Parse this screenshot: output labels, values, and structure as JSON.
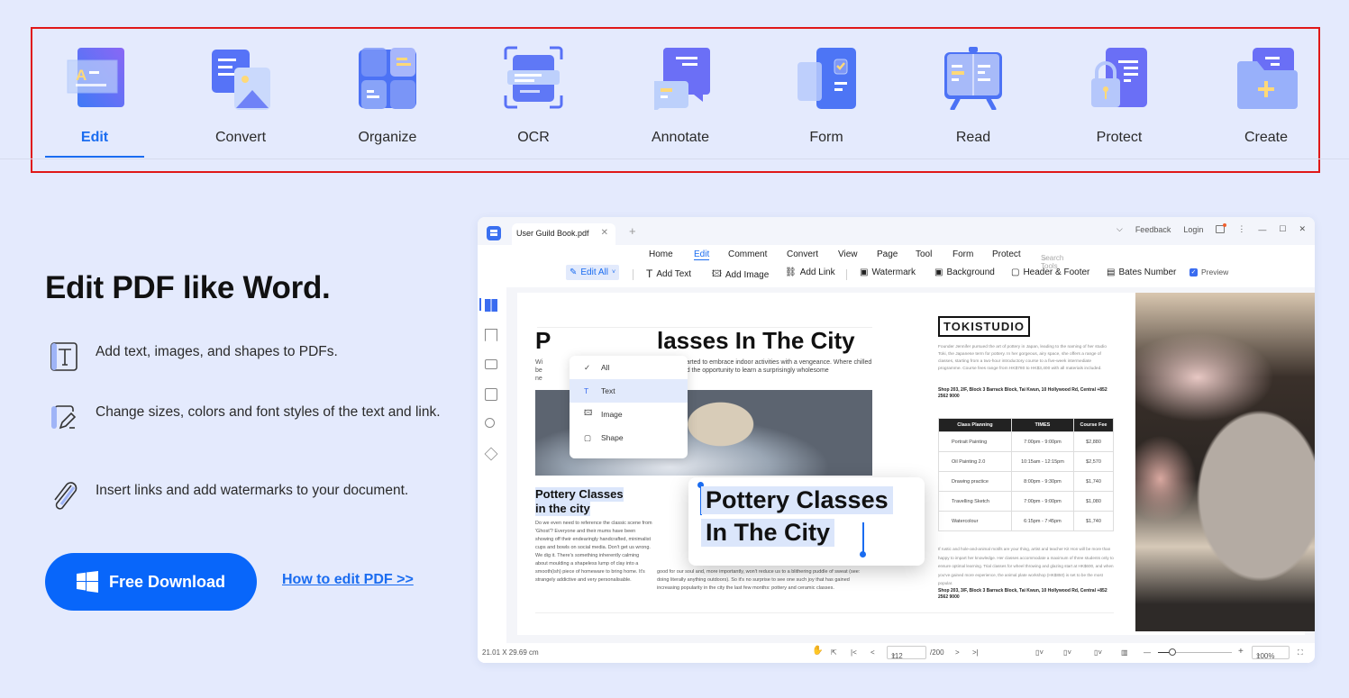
{
  "feature_tabs": [
    {
      "label": "Edit",
      "icon": "edit-document-icon",
      "active": true
    },
    {
      "label": "Convert",
      "icon": "convert-icon",
      "active": false
    },
    {
      "label": "Organize",
      "icon": "organize-icon",
      "active": false
    },
    {
      "label": "OCR",
      "icon": "ocr-scan-icon",
      "active": false
    },
    {
      "label": "Annotate",
      "icon": "annotate-icon",
      "active": false
    },
    {
      "label": "Form",
      "icon": "form-icon",
      "active": false
    },
    {
      "label": "Read",
      "icon": "read-icon",
      "active": false
    },
    {
      "label": "Protect",
      "icon": "protect-lock-icon",
      "active": false
    },
    {
      "label": "Create",
      "icon": "create-icon",
      "active": false
    }
  ],
  "hero": {
    "title": "Edit PDF like Word.",
    "features": [
      {
        "icon": "text-box-icon",
        "text": "Add text, images, and shapes to PDFs."
      },
      {
        "icon": "edit-pen-icon",
        "text": "Change sizes, colors and font styles of the text and link."
      },
      {
        "icon": "paperclip-icon",
        "text": "Insert links and add watermarks to your document."
      }
    ],
    "download_label": "Free Download",
    "how_link": "How to edit PDF >>"
  },
  "colors": {
    "accent": "#0866fa",
    "background": "#e4eafd",
    "highlight_border": "#e01818"
  },
  "app": {
    "tab_title": "User Guild Book.pdf",
    "titlebar_right": {
      "feedback": "Feedback",
      "login": "Login"
    },
    "menu": [
      "Home",
      "Edit",
      "Comment",
      "Convert",
      "View",
      "Page",
      "Tool",
      "Form",
      "Protect"
    ],
    "active_menu": "Edit",
    "search_placeholder": "Search Tools",
    "toolbar": {
      "edit_all": "Edit All",
      "add_text": "Add Text",
      "add_image": "Add Image",
      "add_link": "Add Link",
      "watermark": "Watermark",
      "background": "Background",
      "header_footer": "Header & Footer",
      "bates_number": "Bates Number",
      "preview": "Preview",
      "preview_checked": true
    },
    "dropdown": [
      "All",
      "Text",
      "Image",
      "Shape"
    ],
    "dropdown_selected": "All",
    "dropdown_hover": "Text",
    "document": {
      "headline": "Pottery Classes In The City",
      "headline_visible_part": "lasses In The City",
      "intro": "s, we've started to embrace indoor activities with a vengeance. Where chilled studio? And the opportunity to learn a surprisingly wholesome",
      "sub_heading": [
        "Pottery Classes",
        "in the city"
      ],
      "body_text": "Do we even need to reference the classic scene from 'Ghost'? Everyone and their mums have been showing off their endearingly handcrafted, minimalist cups and bowls on social media. Don't get us wrong. We dig it. There's something inherently calming about moulding a shapeless lump of clay into a smooth(ish) piece of homeware to bring home. It's strangely addictive and very personalisable.",
      "body_text_2": "good for our soul and, more importantly, won't reduce us to a blithering puddle of sweat (see: doing literally anything outdoors). So it's no surprise to see one such joy that has gained increasing popularity in the city the last few months: pottery and ceramic classes.",
      "popup_lines": [
        "Pottery Classes",
        "In The City"
      ],
      "brand": "TOKISTUDIO",
      "brand_text": "Founder Jennifer pursued the art of pottery in Japan, leading to the naming of her studio Toki, the Japanese term for pottery. In her gorgeous, airy space, she offers a range of classes, starting from a two-hour introductory course to a five-week intermediate programme. Course fees range from HK$780 to HK$3,400 with all materials included.",
      "address": "Shop 203, 2/F, Block 3 Barrack Block, Tai Kwun, 10 Hollywood Rd, Central +852 2562 9000",
      "table": {
        "headers": [
          "Class Planning",
          "TIMES",
          "Course Fee"
        ],
        "rows": [
          [
            "Portrait Painting",
            "7:00pm - 9:00pm",
            "$2,880"
          ],
          [
            "Oil Painting 2.0",
            "10:15am - 12:15pm",
            "$2,570"
          ],
          [
            "Drawing practice",
            "8:00pm - 9:30pm",
            "$1,740"
          ],
          [
            "Travelling Sketch",
            "7:00pm - 9:00pm",
            "$1,080"
          ],
          [
            "Watercolour",
            "6:15pm - 7:45pm",
            "$1,740"
          ]
        ]
      },
      "footer_text": "If rustic and hole-and-animal motifs are your thing, artist and teacher Kit Hon will be more than happy to impart her knowledge. Her classes accommodate a maximum of three students only to ensure optimal learning. Trial classes for wheel throwing and glazing start at HK$600, and when you've gained more experience, the animal plate workshop (HK$850) is set to be the most popular.",
      "address_2": "Shop 203, 3/F, Block 3 Barrack Block, Tai Kwun, 10 Hollywood Rd, Central +852 2562 9000"
    },
    "statusbar": {
      "dimensions": "21.01 X 29.69 cm",
      "current_page": "112",
      "total_pages": "/200",
      "zoom": "100%",
      "zoom_slider_fraction": 0.2
    }
  }
}
